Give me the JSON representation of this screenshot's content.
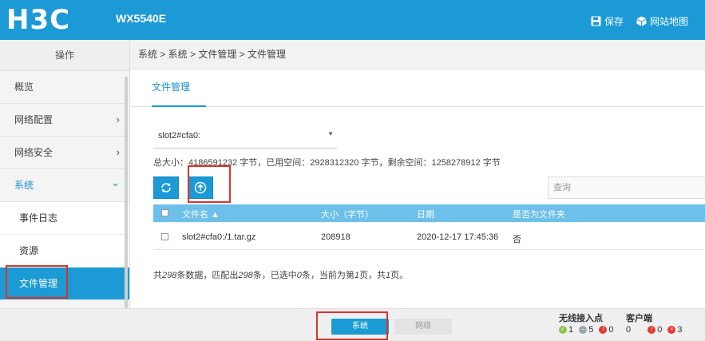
{
  "header": {
    "logo": "H3C",
    "model": "WX5540E",
    "save_label": "保存",
    "sitemap_label": "网站地图"
  },
  "sidebar": {
    "title": "操作",
    "items": [
      {
        "label": "概览"
      },
      {
        "label": "网络配置",
        "chevron": "›"
      },
      {
        "label": "网络安全",
        "chevron": "›"
      },
      {
        "label": "系统",
        "chevron": "⌄"
      }
    ],
    "subitems": [
      {
        "label": "事件日志"
      },
      {
        "label": "资源"
      },
      {
        "label": "文件管理"
      }
    ]
  },
  "breadcrumb": "系统 > 系统 > 文件管理 > 文件管理",
  "tab": "文件管理",
  "device_select": {
    "value": "slot2#cfa0:"
  },
  "summary": "总大小：4186591232 字节，已用空间：2928312320 字节，剩余空间：1258278912 字节",
  "search": {
    "placeholder": "查询"
  },
  "table": {
    "headers": [
      "文件名 ▲",
      "大小（字节）",
      "日期",
      "是否为文件夹"
    ],
    "rows": [
      {
        "name": "slot2#cfa0:/1.tar.gz",
        "size": "208918",
        "date": "2020-12-17 17:45:36",
        "is_folder": "否"
      }
    ]
  },
  "footer": {
    "p1": "共",
    "total": "298",
    "p2": "条数据，匹配出",
    "matched": "298",
    "p3": "条，已选中",
    "selected": "0",
    "p4": "条，当前为第",
    "page": "1",
    "p5": "页，共",
    "pages": "1",
    "p6": "页。"
  },
  "bottom": {
    "tab_system": "系统",
    "tab_network": "网络",
    "ap_title": "无线接入点",
    "client_title": "客户端",
    "ap_counts": [
      "1",
      "5",
      "0"
    ],
    "client_counts": [
      "0",
      "0",
      "3"
    ]
  },
  "colors": {
    "accent": "#1b9ad6",
    "header_row": "#6cc0ea",
    "highlight": "#d9342b"
  }
}
